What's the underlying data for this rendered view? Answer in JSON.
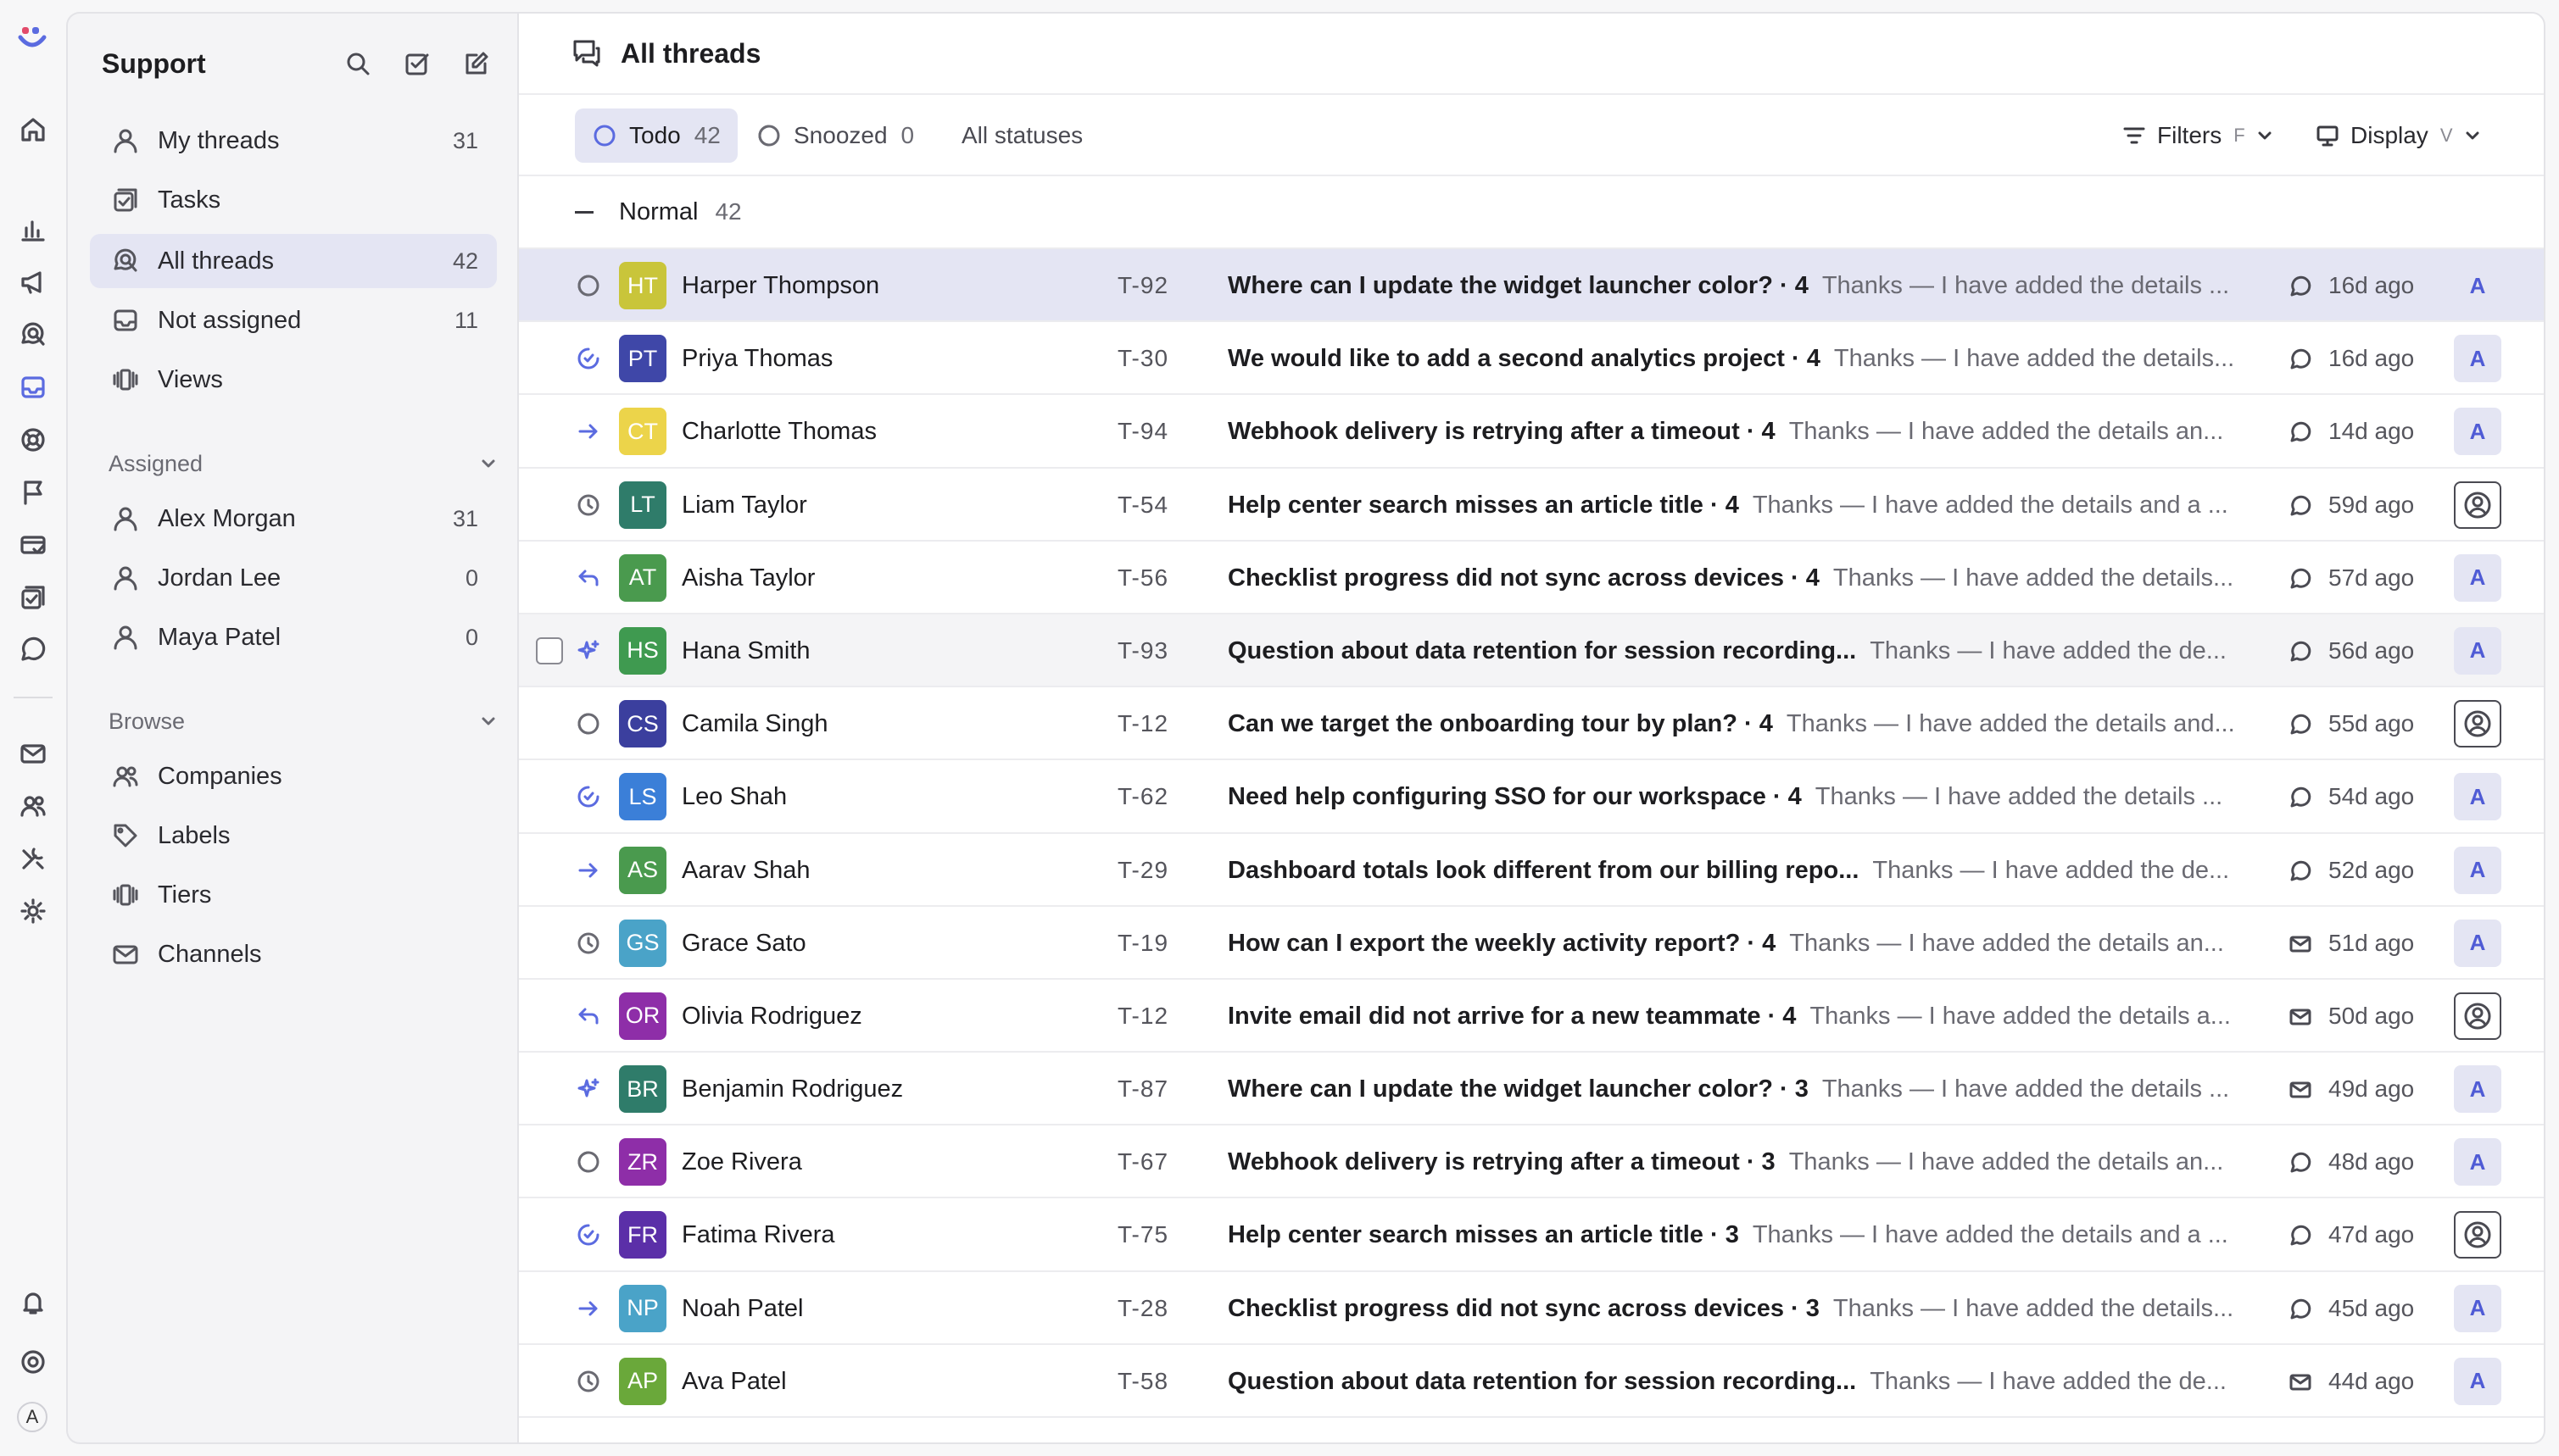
{
  "colors": {
    "accent": "#5b6be0",
    "selected_bg": "#e4e5f3"
  },
  "rail": {
    "avatar_initial": "A",
    "icons": [
      "home-icon",
      "chart-icon",
      "megaphone-icon",
      "search-chat-icon",
      "inbox-icon",
      "lifebuoy-icon",
      "flag-icon",
      "card-icon",
      "tasks-icon",
      "chat-icon",
      "mail-icon",
      "users-icon",
      "tools-icon",
      "gear-icon",
      "bell-icon",
      "help-icon"
    ]
  },
  "sidebar": {
    "title": "Support",
    "items": [
      {
        "label": "My threads",
        "count": "31",
        "icon": "person-icon"
      },
      {
        "label": "Tasks",
        "count": "",
        "icon": "tasks-icon"
      },
      {
        "label": "All threads",
        "count": "42",
        "icon": "search-chat-icon"
      },
      {
        "label": "Not assigned",
        "count": "11",
        "icon": "inbox-icon"
      },
      {
        "label": "Views",
        "count": "",
        "icon": "views-icon"
      }
    ],
    "assigned": {
      "title": "Assigned",
      "items": [
        {
          "label": "Alex Morgan",
          "count": "31"
        },
        {
          "label": "Jordan Lee",
          "count": "0"
        },
        {
          "label": "Maya Patel",
          "count": "0"
        }
      ]
    },
    "browse": {
      "title": "Browse",
      "items": [
        {
          "label": "Companies",
          "icon": "companies-icon"
        },
        {
          "label": "Labels",
          "icon": "tag-icon"
        },
        {
          "label": "Tiers",
          "icon": "tiers-icon"
        },
        {
          "label": "Channels",
          "icon": "mail-icon"
        }
      ]
    }
  },
  "main": {
    "title": "All threads",
    "tabs": [
      {
        "label": "Todo",
        "count": "42"
      },
      {
        "label": "Snoozed",
        "count": "0"
      },
      {
        "label": "All statuses",
        "count": ""
      }
    ],
    "filters": {
      "label": "Filters",
      "key": "F"
    },
    "display": {
      "label": "Display",
      "key": "V"
    },
    "group": {
      "label": "Normal",
      "count": "42"
    },
    "rows": [
      {
        "initials": "HT",
        "color": "#c9c53a",
        "name": "Harper Thompson",
        "id": "T-92",
        "subject": "Where can I update the widget launcher color? · 4",
        "preview": "Thanks — I have added the details ...",
        "ago": "16d ago",
        "status": "snoozed",
        "channel": "chat",
        "assignee": "A"
      },
      {
        "initials": "PT",
        "color": "#3f47a8",
        "name": "Priya Thomas",
        "id": "T-30",
        "subject": "We would like to add a second analytics project · 4",
        "preview": "Thanks — I have added the details...",
        "ago": "16d ago",
        "status": "progress",
        "channel": "chat",
        "assignee": "A"
      },
      {
        "initials": "CT",
        "color": "#ecd44a",
        "name": "Charlotte Thomas",
        "id": "T-94",
        "subject": "Webhook delivery is retrying after a timeout · 4",
        "preview": "Thanks — I have added the details an...",
        "ago": "14d ago",
        "status": "arrow",
        "channel": "chat",
        "assignee": "A"
      },
      {
        "initials": "LT",
        "color": "#2f7c6a",
        "name": "Liam Taylor",
        "id": "T-54",
        "subject": "Help center search misses an article title · 4",
        "preview": "Thanks — I have added the details and a ...",
        "ago": "59d ago",
        "status": "clock",
        "channel": "chat",
        "assignee": ""
      },
      {
        "initials": "AT",
        "color": "#4a9a4e",
        "name": "Aisha Taylor",
        "id": "T-56",
        "subject": "Checklist progress did not sync across devices · 4",
        "preview": "Thanks — I have added the details...",
        "ago": "57d ago",
        "status": "reply",
        "channel": "chat",
        "assignee": "A"
      },
      {
        "initials": "HS",
        "color": "#3f9a50",
        "name": "Hana Smith",
        "id": "T-93",
        "subject": "Question about data retention for session recording...",
        "preview": "Thanks — I have added the de...",
        "ago": "56d ago",
        "status": "sparkle",
        "channel": "chat",
        "assignee": "A"
      },
      {
        "initials": "CS",
        "color": "#3b3f9e",
        "name": "Camila Singh",
        "id": "T-12",
        "subject": "Can we target the onboarding tour by plan? · 4",
        "preview": "Thanks — I have added the details and...",
        "ago": "55d ago",
        "status": "snoozed",
        "channel": "chat",
        "assignee": ""
      },
      {
        "initials": "LS",
        "color": "#3b7fd8",
        "name": "Leo Shah",
        "id": "T-62",
        "subject": "Need help configuring SSO for our workspace · 4",
        "preview": "Thanks — I have added the details ...",
        "ago": "54d ago",
        "status": "progress",
        "channel": "chat",
        "assignee": "A"
      },
      {
        "initials": "AS",
        "color": "#4a9a4e",
        "name": "Aarav Shah",
        "id": "T-29",
        "subject": "Dashboard totals look different from our billing repo...",
        "preview": "Thanks — I have added the de...",
        "ago": "52d ago",
        "status": "arrow",
        "channel": "chat",
        "assignee": "A"
      },
      {
        "initials": "GS",
        "color": "#4aa3c8",
        "name": "Grace Sato",
        "id": "T-19",
        "subject": "How can I export the weekly activity report? · 4",
        "preview": "Thanks — I have added the details an...",
        "ago": "51d ago",
        "status": "clock",
        "channel": "mail",
        "assignee": "A"
      },
      {
        "initials": "OR",
        "color": "#8e2ea8",
        "name": "Olivia Rodriguez",
        "id": "T-12",
        "subject": "Invite email did not arrive for a new teammate · 4",
        "preview": "Thanks — I have added the details a...",
        "ago": "50d ago",
        "status": "reply",
        "channel": "mail",
        "assignee": ""
      },
      {
        "initials": "BR",
        "color": "#2f7c6a",
        "name": "Benjamin Rodriguez",
        "id": "T-87",
        "subject": "Where can I update the widget launcher color? · 3",
        "preview": "Thanks — I have added the details ...",
        "ago": "49d ago",
        "status": "sparkle",
        "channel": "mail",
        "assignee": "A"
      },
      {
        "initials": "ZR",
        "color": "#8e2ea8",
        "name": "Zoe Rivera",
        "id": "T-67",
        "subject": "Webhook delivery is retrying after a timeout · 3",
        "preview": "Thanks — I have added the details an...",
        "ago": "48d ago",
        "status": "snoozed",
        "channel": "chat",
        "assignee": "A"
      },
      {
        "initials": "FR",
        "color": "#5b2fa8",
        "name": "Fatima Rivera",
        "id": "T-75",
        "subject": "Help center search misses an article title · 3",
        "preview": "Thanks — I have added the details and a ...",
        "ago": "47d ago",
        "status": "progress",
        "channel": "chat",
        "assignee": ""
      },
      {
        "initials": "NP",
        "color": "#4aa3c8",
        "name": "Noah Patel",
        "id": "T-28",
        "subject": "Checklist progress did not sync across devices · 3",
        "preview": "Thanks — I have added the details...",
        "ago": "45d ago",
        "status": "arrow",
        "channel": "chat",
        "assignee": "A"
      },
      {
        "initials": "AP",
        "color": "#6aa83a",
        "name": "Ava Patel",
        "id": "T-58",
        "subject": "Question about data retention for session recording...",
        "preview": "Thanks — I have added the de...",
        "ago": "44d ago",
        "status": "clock",
        "channel": "mail",
        "assignee": "A"
      }
    ]
  }
}
